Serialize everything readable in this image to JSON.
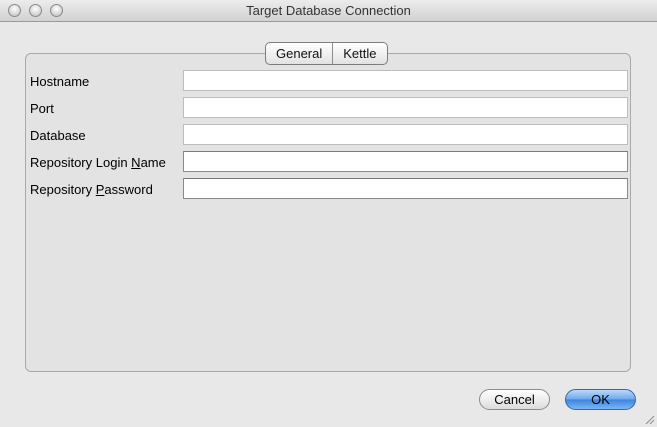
{
  "window": {
    "title": "Target Database Connection"
  },
  "tabs": [
    {
      "label": "General"
    },
    {
      "label": "Kettle"
    }
  ],
  "fields": {
    "hostname": {
      "label": "Hostname",
      "value": ""
    },
    "port": {
      "label": "Port",
      "value": ""
    },
    "database": {
      "label": "Database",
      "value": ""
    },
    "login": {
      "label_pre": "Repository Login ",
      "mnemonic": "N",
      "label_post": "ame",
      "value": ""
    },
    "password": {
      "label_pre": "Repository ",
      "mnemonic": "P",
      "label_post": "assword",
      "value": ""
    }
  },
  "buttons": {
    "cancel": "Cancel",
    "ok": "OK"
  },
  "icons": {
    "close": "close-dot",
    "minimize": "minimize-dot",
    "zoom": "zoom-dot",
    "resize": "resize-grip-icon"
  }
}
